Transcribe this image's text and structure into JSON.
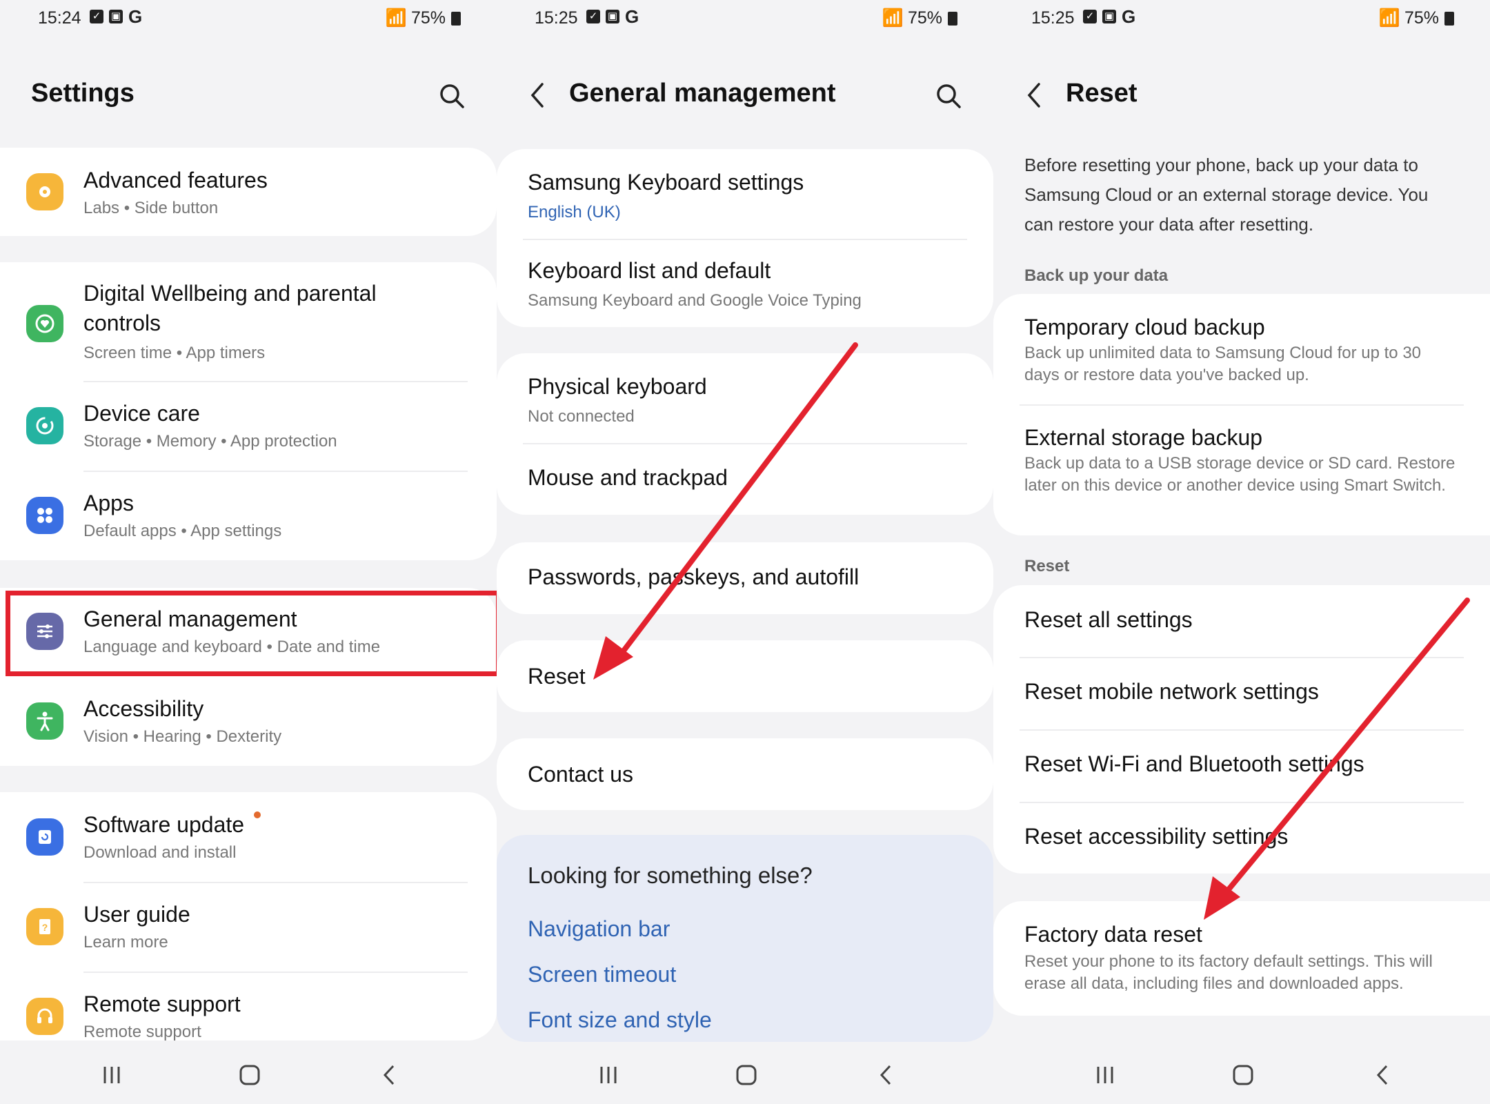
{
  "screens": [
    {
      "status": {
        "time": "15:24",
        "battery": "75%"
      },
      "title": "Settings",
      "items": [
        {
          "title": "Advanced features",
          "sub": "Labs  •  Side button",
          "icon": "puzzle-icon",
          "color": "#f6b63a"
        },
        {
          "title": "Digital Wellbeing and parental",
          "title2": "controls",
          "sub": "Screen time  •  App timers",
          "icon": "wellbeing-icon",
          "color": "#3fb560"
        },
        {
          "title": "Device care",
          "sub": "Storage  •  Memory  •  App protection",
          "icon": "device-care-icon",
          "color": "#25b3a1"
        },
        {
          "title": "Apps",
          "sub": "Default apps  •  App settings",
          "icon": "apps-icon",
          "color": "#3a6fe3"
        },
        {
          "title": "General management",
          "sub": "Language and keyboard  •  Date and time",
          "icon": "sliders-icon",
          "color": "#6669a8"
        },
        {
          "title": "Accessibility",
          "sub": "Vision  •  Hearing  •  Dexterity",
          "icon": "accessibility-icon",
          "color": "#3fb560"
        },
        {
          "title": "Software update",
          "sub": "Download and install",
          "icon": "update-icon",
          "color": "#3a6fe3"
        },
        {
          "title": "User guide",
          "sub": "Learn more",
          "icon": "guide-icon",
          "color": "#f6b63a"
        },
        {
          "title": "Remote support",
          "sub": "Remote support",
          "icon": "headset-icon",
          "color": "#f6b63a"
        }
      ]
    },
    {
      "status": {
        "time": "15:25",
        "battery": "75%"
      },
      "title": "General management",
      "items": [
        {
          "title": "Samsung Keyboard settings",
          "sub": "English (UK)"
        },
        {
          "title": "Keyboard list and default",
          "sub": "Samsung Keyboard and Google Voice Typing"
        },
        {
          "title": "Physical keyboard",
          "sub": "Not connected"
        },
        {
          "title": "Mouse and trackpad"
        },
        {
          "title": "Passwords, passkeys, and autofill"
        },
        {
          "title": "Reset"
        },
        {
          "title": "Contact us"
        }
      ],
      "looking": {
        "heading": "Looking for something else?",
        "links": [
          "Navigation bar",
          "Screen timeout",
          "Font size and style"
        ]
      }
    },
    {
      "status": {
        "time": "15:25",
        "battery": "75%"
      },
      "title": "Reset",
      "intro": "Before resetting your phone, back up your data to Samsung Cloud or an external storage device. You can restore your data after resetting.",
      "backup_label": "Back up your data",
      "backup": [
        {
          "title": "Temporary cloud backup",
          "sub": "Back up unlimited data to Samsung Cloud for up to 30 days or restore data you've backed up."
        },
        {
          "title": "External storage backup",
          "sub": "Back up data to a USB storage device or SD card. Restore later on this device or another device using Smart Switch."
        }
      ],
      "reset_label": "Reset",
      "reset_items": [
        "Reset all settings",
        "Reset mobile network settings",
        "Reset Wi-Fi and Bluetooth settings",
        "Reset accessibility settings"
      ],
      "factory": {
        "title": "Factory data reset",
        "sub": "Reset your phone to its factory default settings. This will erase all data, including files and downloaded apps."
      }
    }
  ],
  "colors": {
    "accent_red": "#e3222e",
    "link_blue": "#2f63b3"
  }
}
